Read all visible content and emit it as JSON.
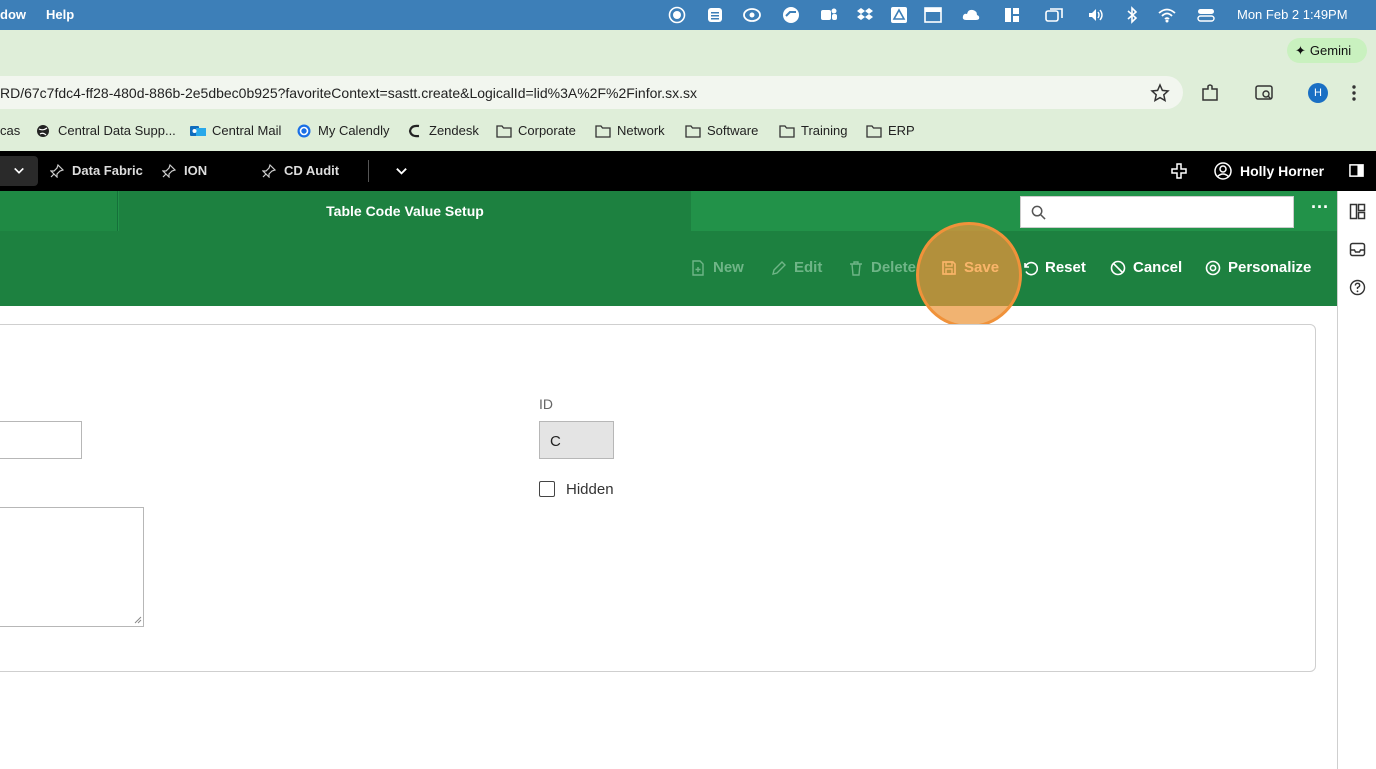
{
  "menubar": {
    "items": [
      "dow",
      "Help"
    ],
    "clock": "Mon Feb 2  1:49PM"
  },
  "tabstrip": {
    "gemini_label": "Gemini"
  },
  "toolbar": {
    "url": "RD/67c7fdc4-ff28-480d-886b-2e5dbec0b925?favoriteContext=sastt.create&LogicalId=lid%3A%2F%2Finfor.sx.sx",
    "profile_initial": "H"
  },
  "bookmarks": [
    {
      "label": "cas",
      "icon": "none"
    },
    {
      "label": "Central Data Supp...",
      "icon": "globe-icon"
    },
    {
      "label": "Central Mail",
      "icon": "outlook-icon"
    },
    {
      "label": "My Calendly",
      "icon": "calendly-icon"
    },
    {
      "label": "Zendesk",
      "icon": "zendesk-icon"
    },
    {
      "label": "Corporate",
      "icon": "folder-icon"
    },
    {
      "label": "Network",
      "icon": "folder-icon"
    },
    {
      "label": "Software",
      "icon": "folder-icon"
    },
    {
      "label": "Training",
      "icon": "folder-icon"
    },
    {
      "label": "ERP",
      "icon": "folder-icon"
    }
  ],
  "appnav": {
    "pinned": [
      "Data Fabric",
      "ION",
      "CD Audit"
    ],
    "user_name": "Holly Horner"
  },
  "header": {
    "title": "Table Code Value Setup"
  },
  "actions": {
    "new": "New",
    "edit": "Edit",
    "delete": "Delete",
    "save": "Save",
    "reset": "Reset",
    "cancel": "Cancel",
    "personalize": "Personalize"
  },
  "form": {
    "id_label": "ID",
    "id_value": "C",
    "hidden_label": "Hidden",
    "hidden_checked": false
  },
  "colors": {
    "menubar": "#3d7fb8",
    "brand_green": "#1d8140",
    "highlight": "#f0923a"
  }
}
